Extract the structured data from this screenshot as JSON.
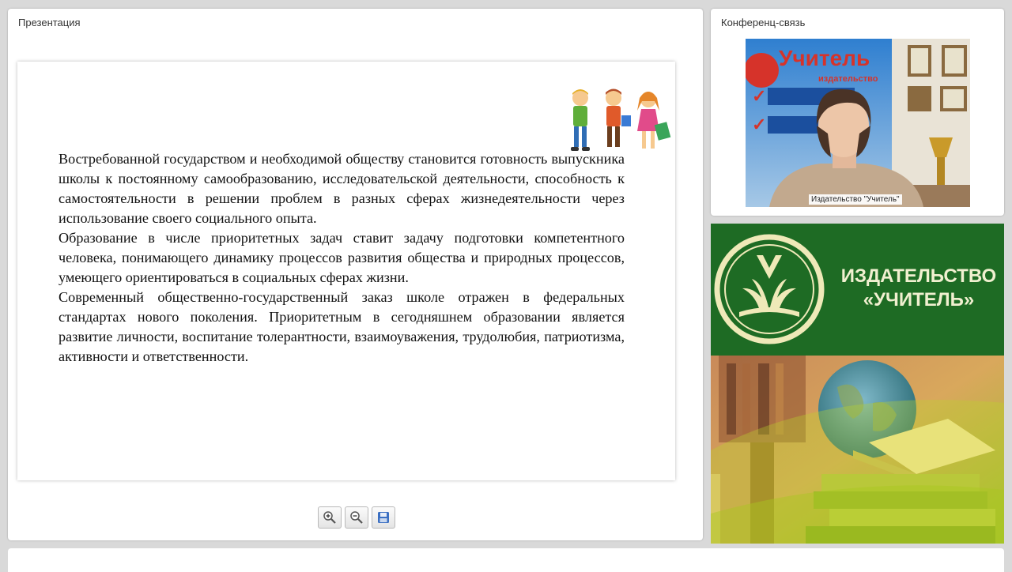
{
  "presentation": {
    "title": "Презентация",
    "paragraphs": [
      "Востребованной государством и необходимой обществу становится готовность выпускника школы к постоянному самообразованию, исследовательской деятельности, способность к самостоятельности в решении проблем в разных сферах жизнедеятельности через использование своего социального опыта.",
      "Образование в числе приоритетных задач ставит задачу подготовки компетентного человека, понимающего динамику процессов развития общества и природных процессов, умеющего ориентироваться в социальных сферах жизни.",
      "Современный общественно-государственный заказ школе отражен в федеральных стандартах нового поколения. Приоритетным в сегодняшнем образовании является развитие личности, воспитание толерантности, взаимоуважения, трудолюбия, патриотизма, активности и ответственности."
    ],
    "toolbar": {
      "zoom_in_icon": "zoom-in-icon",
      "zoom_out_icon": "zoom-out-icon",
      "save_icon": "save-icon"
    }
  },
  "conference": {
    "title": "Конференц-связь",
    "video_label": "Издательство \"Учитель\"",
    "backdrop_title": "Учитель",
    "backdrop_subtitle": "издательство"
  },
  "banner": {
    "line1": "ИЗДАТЕЛЬСТВО",
    "line2": "«УЧИТЕЛЬ»"
  },
  "colors": {
    "banner_green": "#1e6b24",
    "brand_text": "#f1f0d0",
    "page_bg": "#d9d9d9"
  }
}
